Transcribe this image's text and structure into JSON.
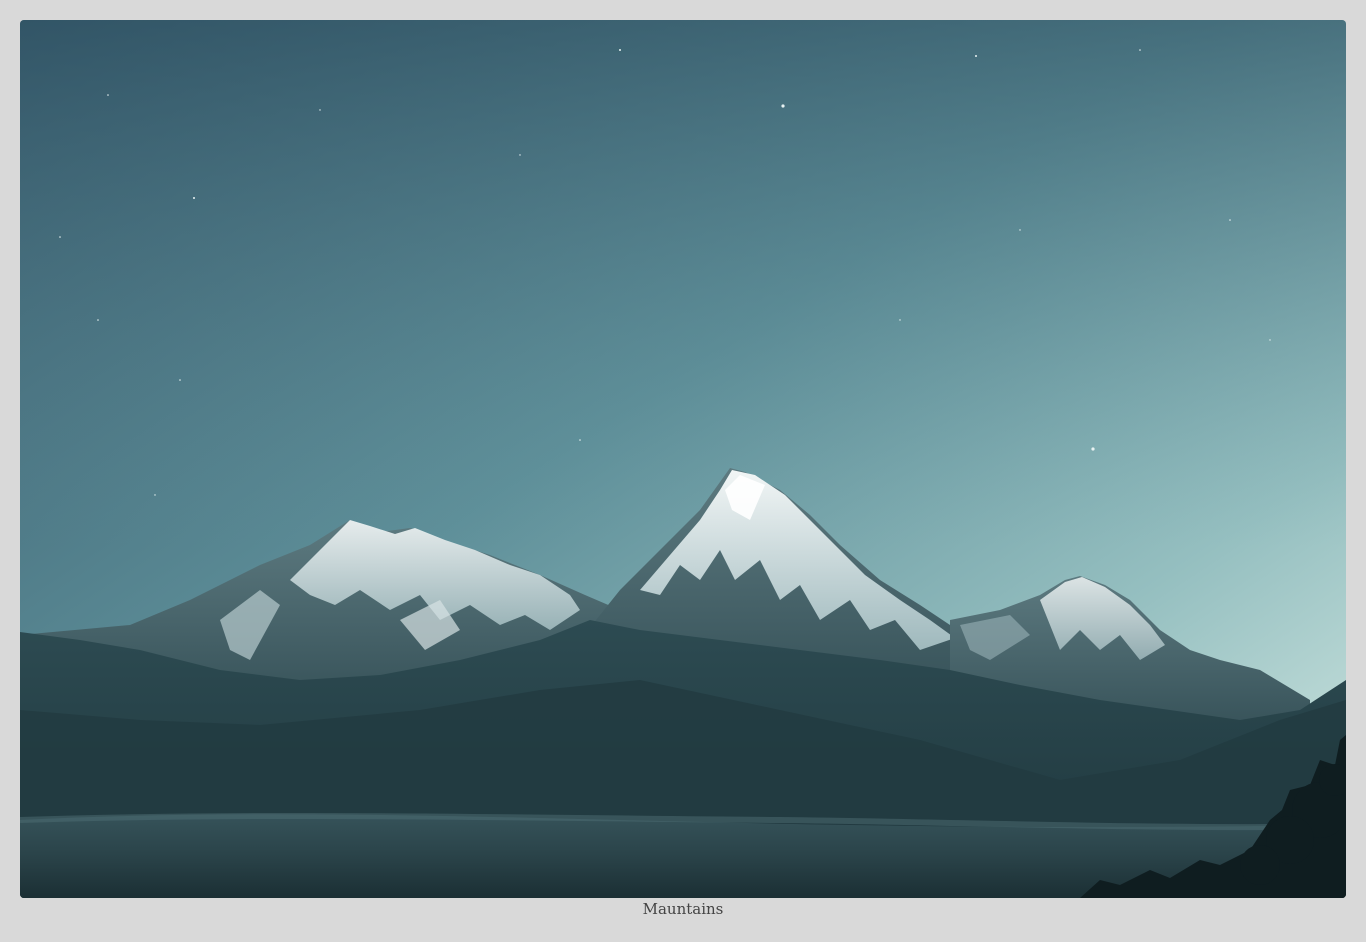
{
  "image": {
    "caption": "Mauntains",
    "icon": "mountain-landscape-photo"
  },
  "colors": {
    "page_background": "#d9d9d9",
    "sky_top": "#3b6373",
    "sky_bottom": "#cfe6e2",
    "caption_text": "#444444"
  }
}
